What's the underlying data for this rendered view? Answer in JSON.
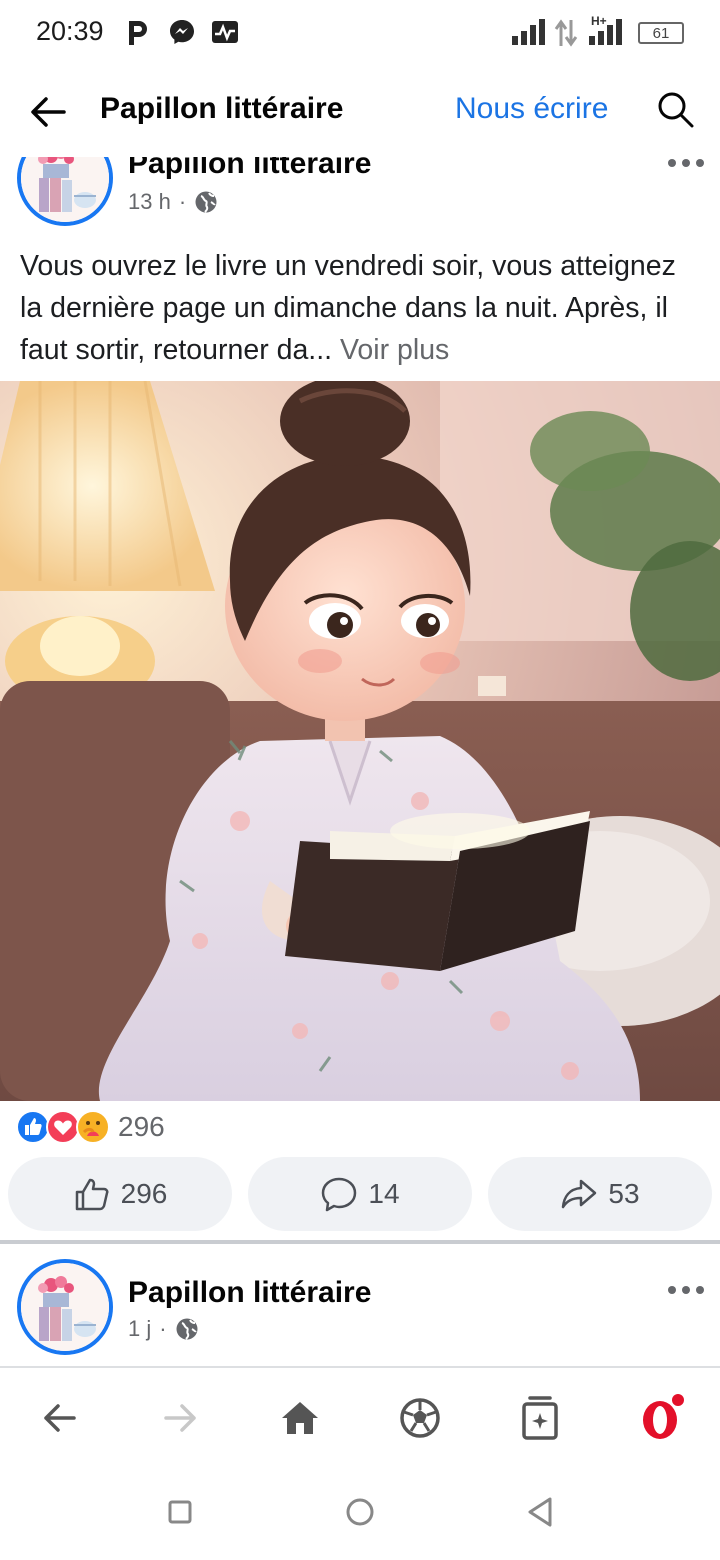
{
  "status_bar": {
    "time": "20:39",
    "network": "H+",
    "battery": "61",
    "icons": [
      "parking-icon",
      "messenger-icon",
      "activity-icon",
      "signal-icon",
      "data-arrows-icon",
      "signal-2-icon",
      "battery-icon"
    ]
  },
  "header": {
    "title": "Papillon littéraire",
    "write_label": "Nous écrire",
    "icons": [
      "back-arrow-icon",
      "search-icon"
    ]
  },
  "post": {
    "author": "Papillon littéraire",
    "time": "13 h",
    "separator": "·",
    "text": "Vous ouvrez le livre un vendredi soir, vous atteignez la dernière page un dimanche dans la nuit. Après, il faut sortir, retourner da...",
    "see_more": " Voir plus",
    "reactions_count": "296",
    "reaction_icons": [
      "like-icon",
      "love-icon",
      "care-icon"
    ],
    "actions": {
      "like_count": "296",
      "comment_count": "14",
      "share_count": "53"
    }
  },
  "post2": {
    "author": "Papillon littéraire",
    "time": "1 j",
    "separator": "·"
  },
  "colors": {
    "accent": "#1877f2",
    "link": "#1b74e4",
    "muted": "#65676b",
    "button_bg": "#f0f2f5",
    "opera_red": "#e3102a"
  },
  "toolbar": {
    "icons": [
      "back-icon",
      "forward-icon",
      "home-icon",
      "soccer-ball-icon",
      "tabs-icon",
      "opera-icon"
    ]
  },
  "navbar": {
    "icons": [
      "recents-square-icon",
      "home-circle-icon",
      "back-triangle-icon"
    ]
  }
}
